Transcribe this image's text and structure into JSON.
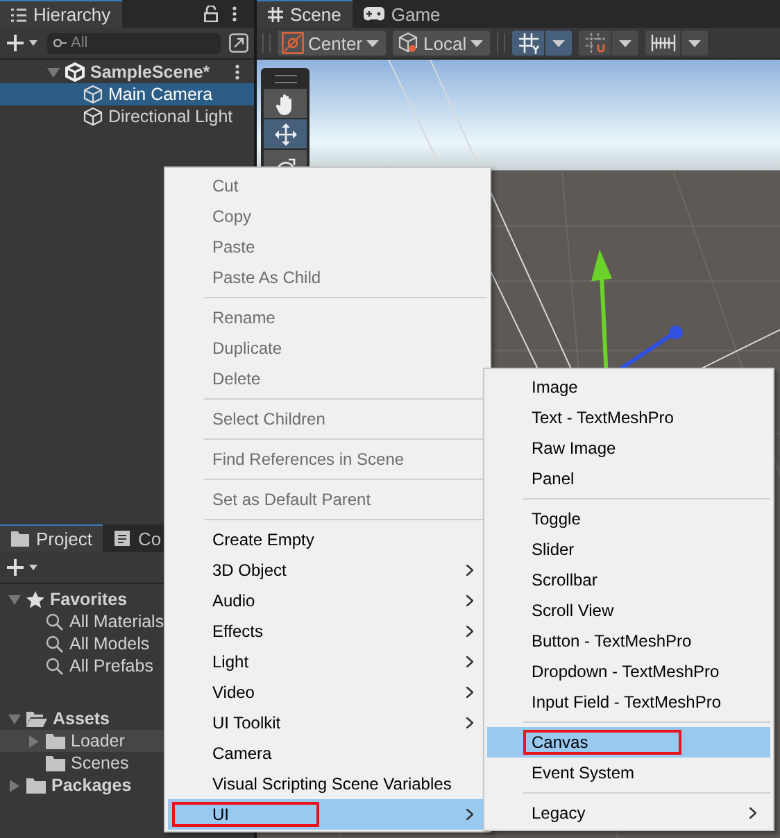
{
  "hierarchy": {
    "title": "Hierarchy",
    "search": {
      "placeholder": "All"
    },
    "scene": {
      "name": "SampleScene*",
      "expanded": true,
      "children": [
        {
          "name": "Main Camera",
          "selected": true
        },
        {
          "name": "Directional Light",
          "selected": false
        }
      ]
    }
  },
  "scene_view": {
    "tabs": [
      {
        "label": "Scene",
        "kind": "scene",
        "selected": true
      },
      {
        "label": "Game",
        "kind": "game",
        "selected": false
      }
    ],
    "dropdowns": [
      {
        "label": "Center",
        "kind": "pivot"
      },
      {
        "label": "Local",
        "kind": "local"
      }
    ],
    "toggles": [
      {
        "kind": "grid",
        "selected": true
      },
      {
        "kind": "snap",
        "selected": false
      },
      {
        "kind": "ruler",
        "selected": false
      }
    ],
    "tools": [
      {
        "kind": "hand",
        "selected": false
      },
      {
        "kind": "move",
        "selected": true
      },
      {
        "kind": "rotate",
        "selected": false
      }
    ]
  },
  "project": {
    "tabs": [
      {
        "label": "Project",
        "kind": "project",
        "selected": true
      },
      {
        "label": "Co",
        "kind": "console",
        "selected": false
      }
    ],
    "tree": [
      {
        "label": "Favorites",
        "kind": "favorites",
        "expanded": true,
        "children": [
          {
            "label": "All Materials",
            "kind": "search"
          },
          {
            "label": "All Models",
            "kind": "search"
          },
          {
            "label": "All Prefabs",
            "kind": "search"
          }
        ]
      },
      {
        "label": "Assets",
        "kind": "open-folder",
        "expanded": true,
        "children": [
          {
            "label": "Loader",
            "kind": "folder",
            "expanded": false,
            "selected": true
          },
          {
            "label": "Scenes",
            "kind": "folder",
            "selected": false
          }
        ]
      },
      {
        "label": "Packages",
        "kind": "folder",
        "expanded": false,
        "selected": false
      }
    ]
  },
  "context_menu": {
    "groups": [
      {
        "items": [
          {
            "label": "Cut",
            "disabled": true
          },
          {
            "label": "Copy",
            "disabled": true
          },
          {
            "label": "Paste",
            "disabled": true
          },
          {
            "label": "Paste As Child",
            "disabled": true
          }
        ]
      },
      {
        "items": [
          {
            "label": "Rename",
            "disabled": true
          },
          {
            "label": "Duplicate",
            "disabled": true
          },
          {
            "label": "Delete",
            "disabled": true
          }
        ]
      },
      {
        "items": [
          {
            "label": "Select Children",
            "disabled": true
          }
        ]
      },
      {
        "items": [
          {
            "label": "Find References in Scene",
            "disabled": true
          }
        ]
      },
      {
        "items": [
          {
            "label": "Set as Default Parent",
            "disabled": true
          }
        ]
      },
      {
        "items": [
          {
            "label": "Create Empty",
            "disabled": false,
            "submenu": false,
            "selected": false
          },
          {
            "label": "3D Object",
            "disabled": false,
            "submenu": true,
            "selected": false
          },
          {
            "label": "Audio",
            "disabled": false,
            "submenu": true,
            "selected": false
          },
          {
            "label": "Effects",
            "disabled": false,
            "submenu": true,
            "selected": false
          },
          {
            "label": "Light",
            "disabled": false,
            "submenu": true,
            "selected": false
          },
          {
            "label": "Video",
            "disabled": false,
            "submenu": true,
            "selected": false
          },
          {
            "label": "UI Toolkit",
            "disabled": false,
            "submenu": true,
            "selected": false
          },
          {
            "label": "Camera",
            "disabled": false,
            "submenu": false,
            "selected": false
          },
          {
            "label": "Visual Scripting Scene Variables",
            "disabled": false,
            "submenu": false,
            "selected": false
          },
          {
            "label": "UI",
            "disabled": false,
            "submenu": true,
            "selected": true,
            "marked": true
          }
        ]
      }
    ]
  },
  "submenu": {
    "groups": [
      {
        "items": [
          {
            "label": "Image"
          },
          {
            "label": "Text - TextMeshPro"
          },
          {
            "label": "Raw Image"
          },
          {
            "label": "Panel"
          }
        ]
      },
      {
        "items": [
          {
            "label": "Toggle"
          },
          {
            "label": "Slider"
          },
          {
            "label": "Scrollbar"
          },
          {
            "label": "Scroll View"
          },
          {
            "label": "Button - TextMeshPro"
          },
          {
            "label": "Dropdown - TextMeshPro"
          },
          {
            "label": "Input Field - TextMeshPro"
          }
        ]
      },
      {
        "items": [
          {
            "label": "Canvas",
            "selected": true,
            "marked": true
          },
          {
            "label": "Event System",
            "selected": false
          }
        ]
      },
      {
        "items": [
          {
            "label": "Legacy",
            "submenu": true,
            "selected": false
          }
        ]
      }
    ]
  }
}
